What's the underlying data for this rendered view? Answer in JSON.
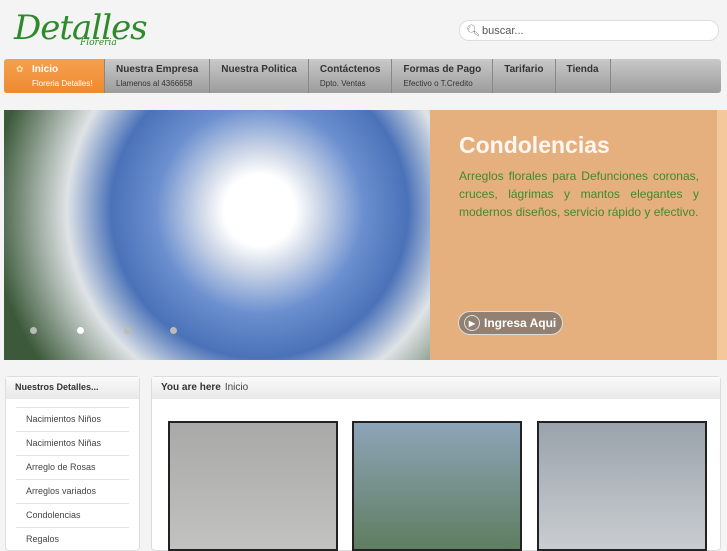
{
  "logo": {
    "text": "Detalles",
    "sub": "Floreria"
  },
  "search": {
    "placeholder": "buscar..."
  },
  "nav": [
    {
      "label": "Inicio",
      "sub": "Floreria Detalles!"
    },
    {
      "label": "Nuestra Empresa",
      "sub": "Llamenos al 4366658"
    },
    {
      "label": "Nuestra Politica",
      "sub": ""
    },
    {
      "label": "Contáctenos",
      "sub": "Dpto. Ventas"
    },
    {
      "label": "Formas de Pago",
      "sub": "Efectivo o T.Credito"
    },
    {
      "label": "Tarifario",
      "sub": ""
    },
    {
      "label": "Tienda",
      "sub": ""
    }
  ],
  "slide": {
    "title": "Condolencias",
    "text": "Arreglos florales para Defunciones coronas, cruces, lágrimas y mantos elegantes y modernos diseños, servicio rápido y efectivo.",
    "button": "Ingresa Aqui"
  },
  "sidebar": {
    "title": "Nuestros Detalles...",
    "items": [
      "Nacimientos Niños",
      "Nacimientos Niñas",
      "Arreglo de Rosas",
      "Arreglos variados",
      "Condolencias",
      "Regalos"
    ]
  },
  "breadcrumb": {
    "label": "You are here",
    "current": "Inicio"
  }
}
